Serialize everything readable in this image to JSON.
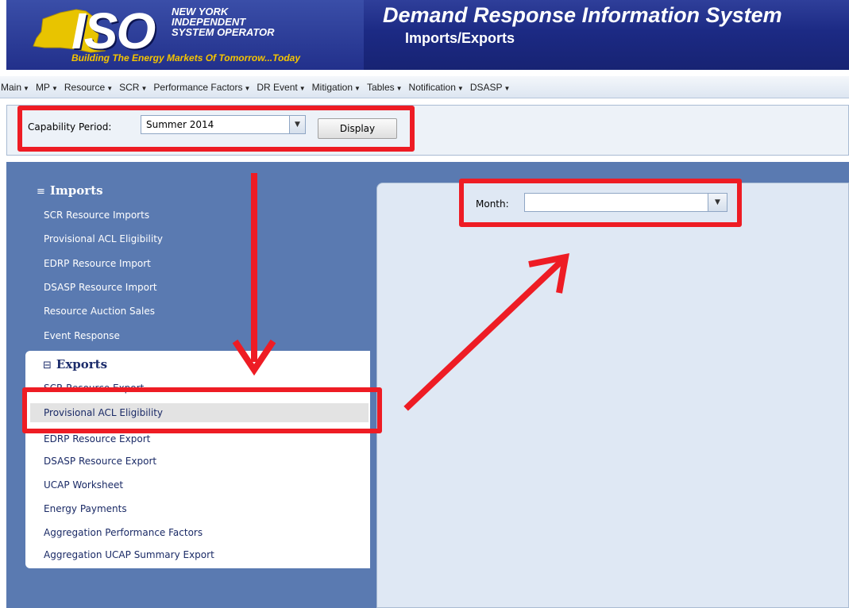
{
  "header": {
    "logo_text": "ISO",
    "logo_org_lines": [
      "NEW YORK",
      "INDEPENDENT",
      "SYSTEM OPERATOR"
    ],
    "logo_tagline": "Building The Energy Markets Of Tomorrow...Today",
    "title": "Demand Response Information System",
    "subtitle": "Imports/Exports"
  },
  "menu": [
    {
      "label": "Main"
    },
    {
      "label": "MP"
    },
    {
      "label": "Resource"
    },
    {
      "label": "SCR"
    },
    {
      "label": "Performance Factors"
    },
    {
      "label": "DR Event"
    },
    {
      "label": "Mitigation"
    },
    {
      "label": "Tables"
    },
    {
      "label": "Notification"
    },
    {
      "label": "DSASP"
    }
  ],
  "toolbar": {
    "capability_label": "Capability Period:",
    "capability_value": "Summer 2014",
    "display_button": "Display"
  },
  "sidebar": {
    "imports_title": "Imports",
    "imports_items": [
      "SCR Resource Imports",
      "Provisional ACL Eligibility",
      "EDRP Resource Import",
      "DSASP Resource Import",
      "Resource Auction Sales",
      "Event Response"
    ],
    "exports_title": "Exports",
    "exports_items": [
      "SCR Resource Export",
      "Provisional ACL Eligibility",
      "EDRP Resource Export",
      "DSASP Resource Export",
      "UCAP Worksheet",
      "Energy Payments",
      "Aggregation Performance Factors",
      "Aggregation UCAP Summary Export"
    ],
    "selected_export_index": 1
  },
  "main": {
    "month_label": "Month:",
    "month_value": ""
  },
  "colors": {
    "header_blue": "#1c2a84",
    "sidebar_blue": "#5a7ab1",
    "tagline_yellow": "#f5c400",
    "annotation_red": "#ee1c24",
    "panel_bg": "#dfe8f4"
  },
  "icons": {
    "dropdown_arrow": "chevron-down-icon",
    "section_toggle": "collapse-square-icon",
    "menu_caret": "caret-down-icon"
  }
}
